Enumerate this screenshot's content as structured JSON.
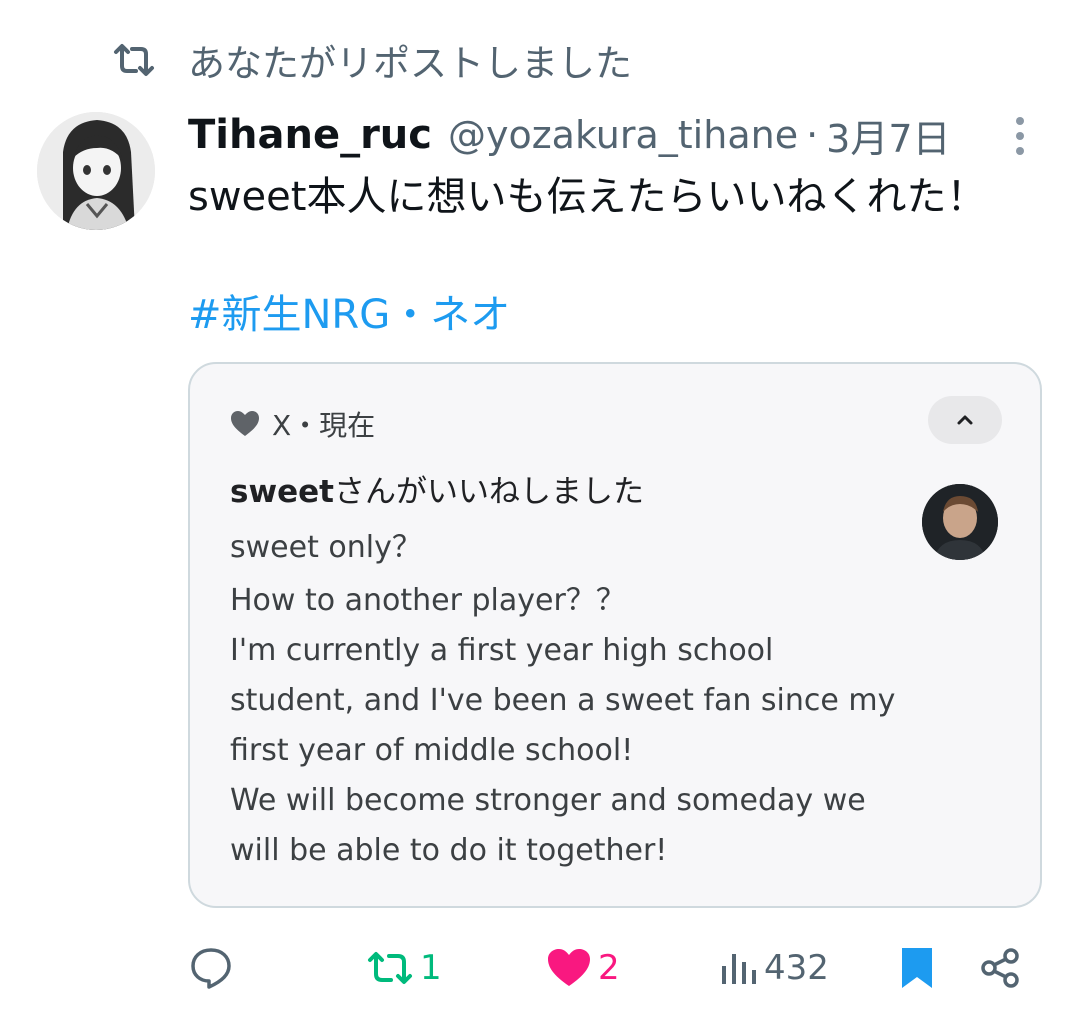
{
  "repost_banner": {
    "icon": "repost-icon",
    "text": "あなたがリポストしました"
  },
  "tweet": {
    "display_name": "Tihane_ruc",
    "handle": "@yozakura_tihane",
    "separator": "·",
    "date": "3月7日",
    "text": "sweet本人に想いも伝えたらいいねくれた！",
    "hashtag": "#新生NRG・ネオ"
  },
  "embedded_card": {
    "source_label": "X・現在",
    "notification_liker": "sweet",
    "notification_suffix": "さんがいいねしました",
    "subtitle": "sweet only？",
    "message": [
      "How to another player？？",
      "I'm currently a first year high school",
      "student, and I've been a sweet fan since my",
      "first year of middle school!",
      "We will become stronger and someday we",
      "will be able to do it together!"
    ]
  },
  "actions": {
    "reply_icon": "reply-icon",
    "repost_count": "1",
    "like_count": "2",
    "views_count": "432",
    "bookmark_icon": "bookmark-icon",
    "share_icon": "share-icon"
  },
  "colors": {
    "text": "#0f1419",
    "muted": "#536471",
    "link": "#1d9bf0",
    "repost_active": "#00ba7c",
    "like_active": "#f91880",
    "bookmark_active": "#1d9bf0",
    "card_border": "#cfd9de"
  }
}
